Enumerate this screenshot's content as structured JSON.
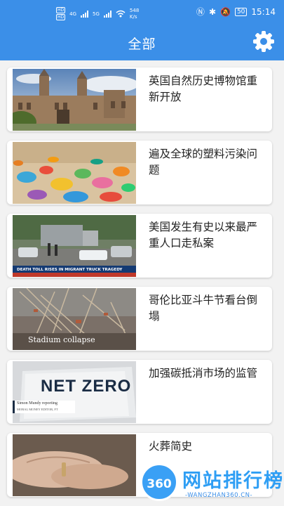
{
  "status_bar": {
    "hd1": "HD",
    "net1": "4G",
    "hd2": "HD",
    "net2": "5G",
    "speed_value": "548",
    "speed_unit": "K/s",
    "battery": "50",
    "time": "15:14"
  },
  "header": {
    "title": "全部",
    "settings_icon": "gear-icon"
  },
  "news": [
    {
      "title": "英国自然历史博物馆重新开放",
      "image": "natural-history-museum-photo"
    },
    {
      "title": "遍及全球的塑料污染问题",
      "image": "plastic-waste-photo"
    },
    {
      "title": "美国发生有史以来最严重人口走私案",
      "image": "migrant-truck-news-photo",
      "caption": "DEATH TOLL RISES IN MIGRANT TRUCK TRAGEDY"
    },
    {
      "title": "哥伦比亚斗牛节看台倒塌",
      "image": "stadium-collapse-photo",
      "caption": "Stadium collapse"
    },
    {
      "title": "加强碳抵消市场的监管",
      "image": "net-zero-news-photo",
      "caption": "NET ZERO",
      "reporter": "Simon Mundy reporting",
      "reporter_role": "MORAL MONEY EDITOR, FT"
    },
    {
      "title": "火葬简史",
      "image": "hand-photo"
    }
  ],
  "watermark": {
    "logo": "360",
    "name": "网站排行榜",
    "url": "WANGZHAN360.CN"
  },
  "colors": {
    "header_bg": "#3b8fe8",
    "page_bg": "#f2f2f2",
    "card_bg": "#ffffff",
    "title_text": "#222222"
  }
}
